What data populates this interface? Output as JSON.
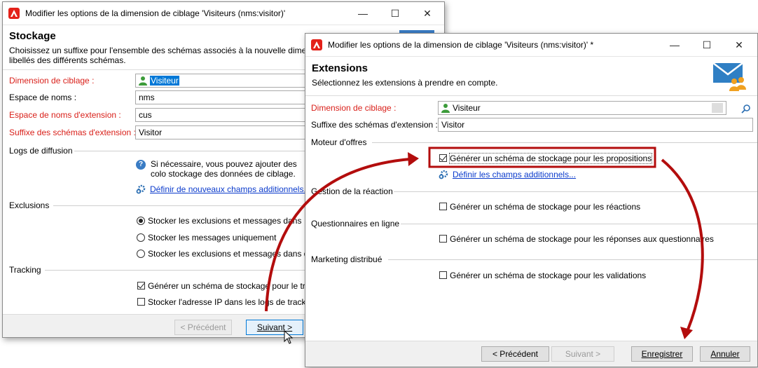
{
  "back": {
    "title": "Modifier les options de la dimension de ciblage 'Visiteurs (nms:visitor)'",
    "header": {
      "title": "Stockage",
      "description": "Choisissez un suffixe pour l'ensemble des schémas associés à la nouvelle dimens les libellés des différents schémas."
    },
    "fields": {
      "dimension_label": "Dimension de ciblage :",
      "dimension_value": "Visiteur",
      "namespace_label": "Espace de noms :",
      "namespace_value": "nms",
      "ext_namespace_label": "Espace de noms d'extension :",
      "ext_namespace_value": "cus",
      "suffix_label": "Suffixe des schémas d'extension :",
      "suffix_value": "Visitor"
    },
    "logs": {
      "section": "Logs de diffusion",
      "help_text": "Si nécessaire, vous pouvez ajouter des colo stockage des données de ciblage.",
      "link": "Définir de nouveaux champs additionnels..."
    },
    "exclusions": {
      "section": "Exclusions",
      "options": [
        "Stocker les exclusions et messages dans",
        "Stocker les messages uniquement",
        "Stocker les exclusions et messages dans de"
      ]
    },
    "tracking": {
      "section": "Tracking",
      "options": [
        "Générer un schéma de stockage pour le tra",
        "Stocker l'adresse IP dans les logs de trackin"
      ]
    },
    "buttons": {
      "previous": "< Précédent",
      "next": "Suivant >"
    }
  },
  "front": {
    "title": "Modifier les options de la dimension de ciblage 'Visiteurs (nms:visitor)' *",
    "header": {
      "title": "Extensions",
      "description": "Sélectionnez les extensions à prendre en compte."
    },
    "fields": {
      "dimension_label": "Dimension de ciblage :",
      "dimension_value": "Visiteur",
      "suffix_label": "Suffixe des schémas d'extension :",
      "suffix_value": "Visitor"
    },
    "offers": {
      "section": "Moteur d'offres",
      "checkbox": "Générer un schéma de stockage pour les propositions",
      "link": "Définir les champs additionnels..."
    },
    "reaction": {
      "section": "Gestion de la réaction",
      "checkbox": "Générer un schéma de stockage pour les réactions"
    },
    "surveys": {
      "section": "Questionnaires en ligne",
      "checkbox": "Générer un schéma de stockage pour les réponses aux questionnaires"
    },
    "marketing": {
      "section": "Marketing distribué",
      "checkbox": "Générer un schéma de stockage pour les validations"
    },
    "buttons": {
      "previous": "< Précédent",
      "next": "Suivant >",
      "save": "Enregistrer",
      "cancel": "Annuler"
    }
  },
  "icons": {
    "minimize": "minimize-icon",
    "maximize": "maximize-icon",
    "close": "close-icon",
    "accent": "#c40c0c"
  }
}
